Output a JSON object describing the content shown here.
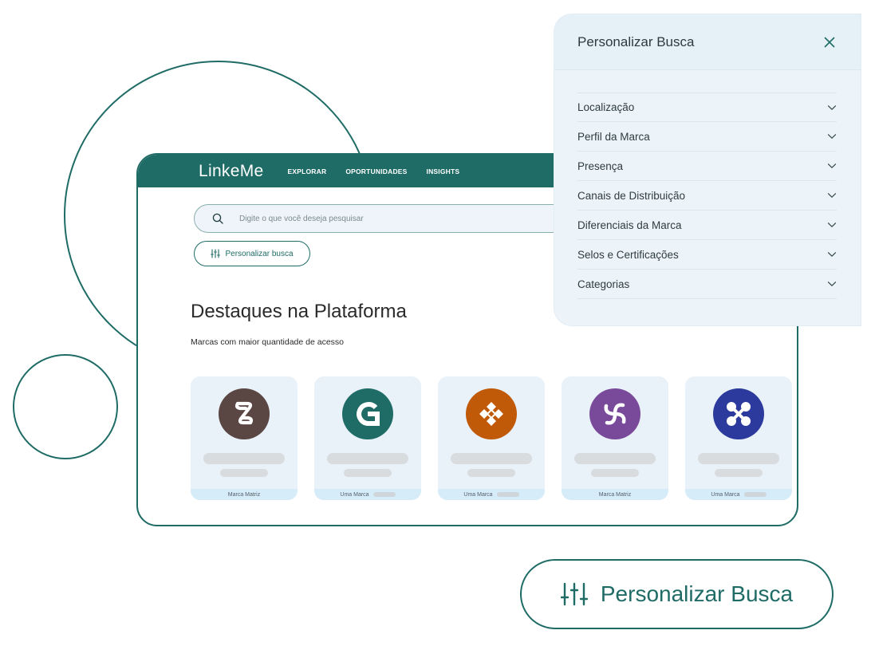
{
  "header": {
    "logo": "LinkeMe",
    "nav": [
      "EXPLORAR",
      "OPORTUNIDADES",
      "INSIGHTS"
    ]
  },
  "search": {
    "placeholder": "Digite o que você deseja pesquisar",
    "customize_label": "Personalizar busca"
  },
  "featured": {
    "title": "Destaques na Plataforma",
    "subtitle": "Marcas com maior quantidade de acesso"
  },
  "brands": [
    {
      "footer": "Marca Matriz",
      "color": "#5a4643",
      "icon": "chain-link-icon"
    },
    {
      "footer": "Uma Marca",
      "color": "#1f6b66",
      "icon": "g-shape-icon"
    },
    {
      "footer": "Uma Marca",
      "color": "#c05a08",
      "icon": "diamond-icon"
    },
    {
      "footer": "Marca Matriz",
      "color": "#7a4a9a",
      "icon": "swirl-icon"
    },
    {
      "footer": "Uma Marca",
      "color": "#2b3a9c",
      "icon": "molecule-icon"
    }
  ],
  "panel": {
    "title": "Personalizar Busca",
    "filters": [
      "Localização",
      "Perfil da Marca",
      "Presença",
      "Canais de Distribuição",
      "Diferenciais da Marca",
      "Selos e Certificações",
      "Categorias"
    ]
  },
  "cta": {
    "label": "Personalizar Busca"
  },
  "colors": {
    "primary": "#1f6b66",
    "panel_bg": "#ecf4fa",
    "card_bg": "#e9f1f9"
  }
}
